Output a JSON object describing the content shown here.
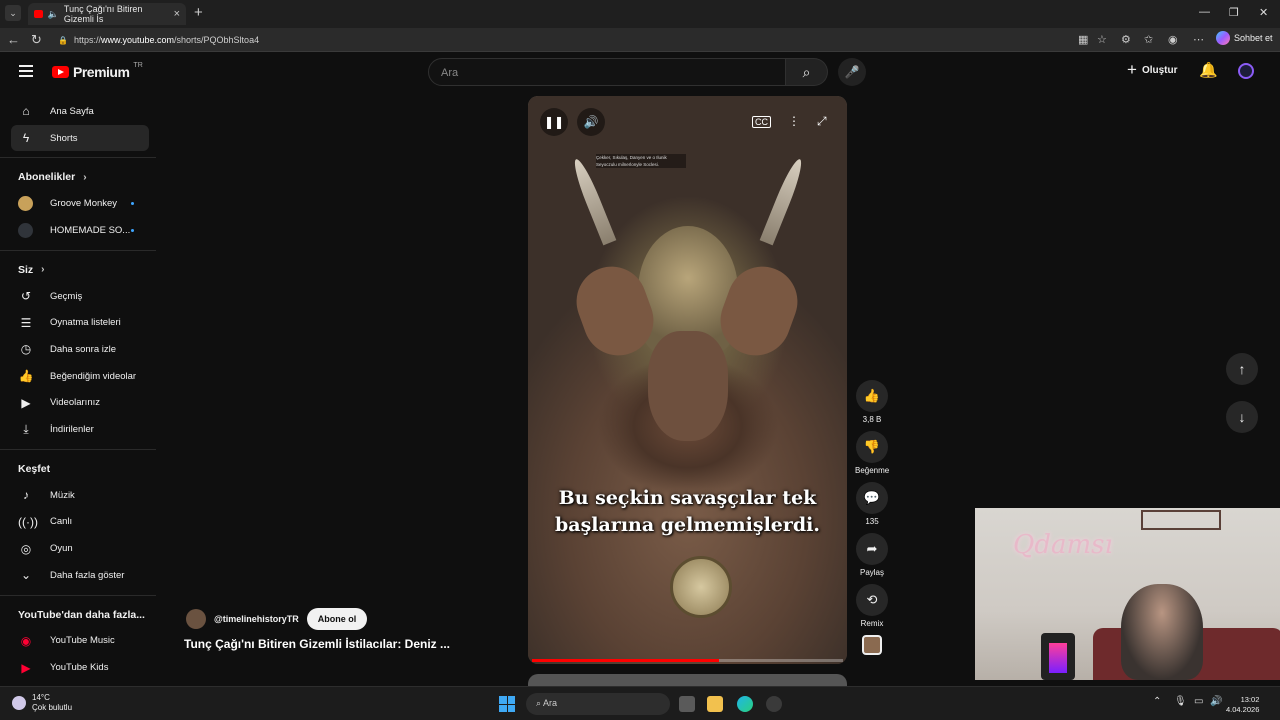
{
  "browser": {
    "tab_title": "Tunç Çağı'nı Bitiren Gizemli İs",
    "url_prefix": "https://",
    "url_host": "www.youtube.com",
    "url_path": "/shorts/PQObhSltoa4",
    "copilot_label": "Sohbet et"
  },
  "header": {
    "logo_text": "Premium",
    "logo_region": "TR",
    "search_placeholder": "Ara",
    "create_label": "Oluştur"
  },
  "sidebar": {
    "main": [
      {
        "label": "Ana Sayfa",
        "icon": "home-icon"
      },
      {
        "label": "Shorts",
        "icon": "shorts-icon",
        "active": true
      }
    ],
    "subscriptions_title": "Abonelikler",
    "subscriptions": [
      {
        "label": "Groove Monkey",
        "avatar_color": "#c8a15a"
      },
      {
        "label": "HOMEMADE SO...",
        "avatar_color": "#30343a"
      }
    ],
    "you_title": "Siz",
    "you": [
      {
        "label": "Geçmiş",
        "icon": "history-icon"
      },
      {
        "label": "Oynatma listeleri",
        "icon": "playlist-icon"
      },
      {
        "label": "Daha sonra izle",
        "icon": "clock-icon"
      },
      {
        "label": "Beğendiğim videolar",
        "icon": "thumbs-up-icon"
      },
      {
        "label": "Videolarınız",
        "icon": "video-icon"
      },
      {
        "label": "İndirilenler",
        "icon": "download-icon"
      }
    ],
    "explore_title": "Keşfet",
    "explore": [
      {
        "label": "Müzik",
        "icon": "music-icon"
      },
      {
        "label": "Canlı",
        "icon": "live-icon"
      },
      {
        "label": "Oyun",
        "icon": "game-icon"
      },
      {
        "label": "Daha fazla göster",
        "icon": "chevron-down-icon"
      }
    ],
    "more_title": "YouTube'dan daha fazla...",
    "more": [
      {
        "label": "YouTube Music",
        "icon": "youtube-music-icon"
      },
      {
        "label": "YouTube Kids",
        "icon": "youtube-kids-icon"
      }
    ]
  },
  "short": {
    "subtitle_line1": "Bu seçkin savaşçılar tek",
    "subtitle_line2": "başlarına gelmemişlerdi.",
    "mini_caption": "Çekker, Sıkulaş, Danyen ve o Ilunik Seyoczulu milnerlonyle Soclesi.",
    "progress_fraction": 0.6,
    "channel": "@timelinehistoryTR",
    "subscribe_label": "Abone ol",
    "title": "Tunç Çağı'nı Bitiren Gizemli İstilacılar: Deniz ..."
  },
  "actions": {
    "likes": "3,8 B",
    "dislike_label": "Beğenme",
    "comments": "135",
    "share_label": "Paylaş",
    "remix_label": "Remix"
  },
  "webcam": {
    "neon_sign": "Qdamsı"
  },
  "taskbar": {
    "temperature": "14°C",
    "weather": "Çok bulutlu",
    "search_label": "Ara",
    "time": "13:02",
    "date": "4.04.2026"
  }
}
